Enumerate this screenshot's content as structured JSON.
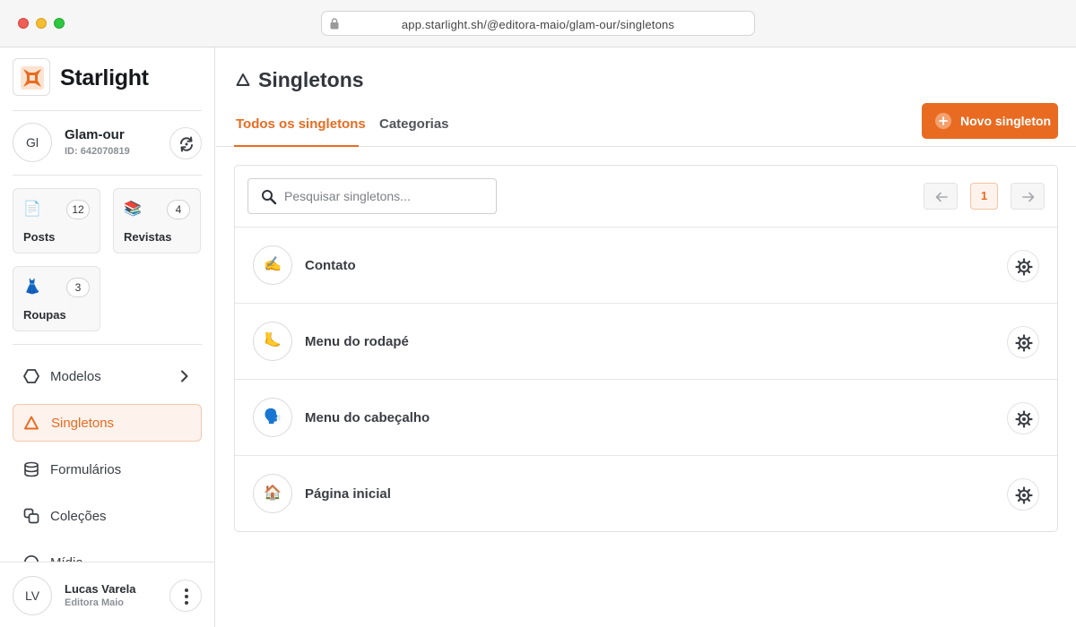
{
  "browser": {
    "url": "app.starlight.sh/@editora-maio/glam-our/singletons"
  },
  "sidebar": {
    "brand": "Starlight",
    "project": {
      "initials": "Gl",
      "name": "Glam-our",
      "id_label": "ID: 642070819"
    },
    "content_cards": [
      {
        "emoji": "📄",
        "icon": "document-icon",
        "count": "12",
        "label": "Posts"
      },
      {
        "emoji": "📚",
        "icon": "books-icon",
        "count": "4",
        "label": "Revistas"
      },
      {
        "emoji": "👗",
        "icon": "dress-icon",
        "count": "3",
        "label": "Roupas"
      }
    ],
    "nav": [
      {
        "label": "Modelos",
        "icon": "hexagon-icon"
      },
      {
        "label": "Singletons",
        "icon": "triangle-icon",
        "active": true
      },
      {
        "label": "Formulários",
        "icon": "database-icon"
      },
      {
        "label": "Coleções",
        "icon": "collection-icon"
      },
      {
        "label": "Mídia",
        "icon": "media-icon"
      }
    ],
    "user": {
      "initials": "LV",
      "name": "Lucas Varela",
      "role": "Editora Maio"
    }
  },
  "main": {
    "title": "Singletons",
    "tabs": [
      {
        "label": "Todos os singletons",
        "active": true
      },
      {
        "label": "Categorias"
      }
    ],
    "new_button_label": "Novo singleton",
    "search_placeholder": "Pesquisar singletons...",
    "pagination": {
      "current_page": "1"
    },
    "singletons": [
      {
        "emoji": "✍️",
        "icon": "writing-hand-icon",
        "name": "Contato"
      },
      {
        "emoji": "🦶",
        "icon": "foot-icon",
        "name": "Menu do rodapé"
      },
      {
        "emoji": "🗣️",
        "icon": "speaking-head-icon",
        "name": "Menu do cabeçalho"
      },
      {
        "emoji": "🏠",
        "icon": "house-icon",
        "name": "Página inicial"
      }
    ]
  },
  "colors": {
    "accent": "#e86b21",
    "accent_bg": "#fdf2ec"
  }
}
